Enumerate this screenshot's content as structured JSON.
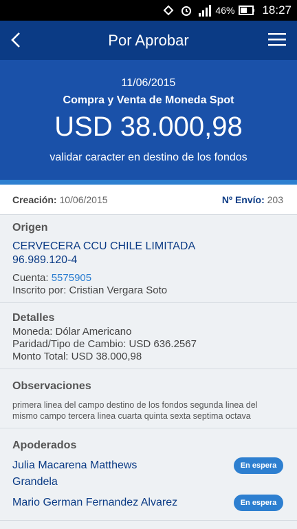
{
  "status_bar": {
    "battery": "46%",
    "time": "18:27"
  },
  "app_bar": {
    "title": "Por Aprobar"
  },
  "hero": {
    "date": "11/06/2015",
    "operation": "Compra y Venta de Moneda Spot",
    "amount": "USD 38.000,98",
    "destination": "validar caracter en destino de los fondos"
  },
  "meta": {
    "created_label": "Creación:",
    "created_value": "10/06/2015",
    "shipment_label": "Nº Envío:",
    "shipment_value": "203"
  },
  "origin": {
    "heading": "Origen",
    "company": "CERVECERA CCU CHILE LIMITADA",
    "rut": "96.989.120-4",
    "account_label": "Cuenta:",
    "account_value": "5575905",
    "registered_by": "Inscrito por: Cristian Vergara Soto"
  },
  "details": {
    "heading": "Detalles",
    "currency": "Moneda: Dólar Americano",
    "parity": "Paridad/Tipo de Cambio: USD 636.2567",
    "total": "Monto Total: USD 38.000,98"
  },
  "observations": {
    "heading": "Observaciones",
    "text_line1": "primera linea del campo destino de los fondos segunda linea del",
    "text_line2": "mismo campo tercera linea cuarta quinta sexta septima octava"
  },
  "proxies": {
    "heading": "Apoderados",
    "items": [
      {
        "name_line1": "Julia Macarena Matthews",
        "name_line2": "Grandela",
        "status": "En espera"
      },
      {
        "name_line1": "Mario German Fernandez Alvarez",
        "name_line2": "",
        "status": "En espera"
      }
    ]
  },
  "icons": {
    "back": "back-arrow-icon",
    "menu": "hamburger-menu-icon"
  }
}
